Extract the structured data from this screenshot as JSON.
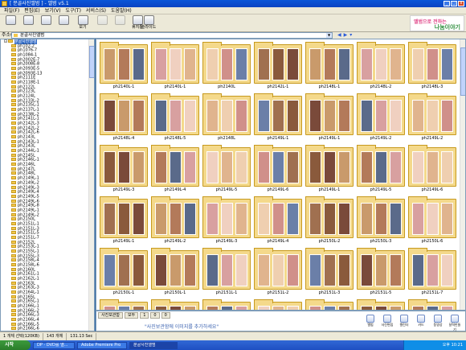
{
  "window": {
    "title": "[ 분골사진앨범 ] - 앨범 v5.1",
    "buttons": [
      "_",
      "□",
      "x"
    ]
  },
  "menu": [
    "파일(F)",
    "편집(E)",
    "보기(V)",
    "도구(T)",
    "서비스(S)",
    "도움말(H)"
  ],
  "toolbar": {
    "buttons": [
      {
        "label": "",
        "icon": "back-icon"
      },
      {
        "label": "",
        "icon": "forward-icon"
      },
      {
        "label": "",
        "icon": "up-folder-icon"
      },
      {
        "label": "",
        "icon": "refresh-icon"
      },
      {
        "label": "보기",
        "icon": "view-icon"
      },
      {
        "label": "",
        "icon": "copy-icon"
      },
      {
        "label": "",
        "icon": "paste-icon"
      },
      {
        "label": "휴지통",
        "icon": "trash-icon"
      },
      {
        "label": "슬라이드",
        "icon": "slideshow-icon"
      }
    ],
    "banner_line1": "앨범으로 전하는",
    "banner_line2": "나눔이야기"
  },
  "address": {
    "label": "주소(D)",
    "value": "분골사진앨범"
  },
  "tree": {
    "root": "분골사진앨범",
    "items": [
      "ph102-2",
      "ph1076-7",
      "ph1084-1",
      "ph2002E-7",
      "ph2008E-8",
      "ph2093E-5",
      "ph2093E-13",
      "ph2111E",
      "ph2118E-1",
      "ph2122L",
      "ph2123L",
      "ph2124L",
      "ph2133L-2",
      "ph2135L-1",
      "ph2137L-1",
      "ph2138L-2",
      "ph2141L-1",
      "ph2142L-3",
      "ph2142L-2",
      "ph2142L-6",
      "ph2143L",
      "ph2143L-1",
      "ph2143L",
      "ph2144L-1",
      "ph2145L",
      "ph2146L-1",
      "ph2146L",
      "ph2147L",
      "ph2148L",
      "ph2149L-1",
      "ph2149L-2",
      "ph2149L-3",
      "ph2149L-4",
      "ph2149L-5",
      "ph2149L-6",
      "ph2149L-8",
      "ph2149L-1",
      "ph2149L-2",
      "ph2150L",
      "ph2151L-1",
      "ph2151L-3",
      "ph2151L-5",
      "ph2151L-7",
      "ph2152L",
      "ph2153L-1",
      "ph2155L-1",
      "ph2155L-3",
      "ph2158L-4",
      "ph2158L-6",
      "ph2160L",
      "ph2161L-1",
      "ph2162L-1",
      "ph2163L",
      "ph2163L-3",
      "ph2164L-1",
      "ph2165L",
      "ph2165L-1",
      "ph2166L-1",
      "ph2166L-2",
      "ph2166L-3",
      "ph2166L-4",
      "ph2166L-5",
      "ph2166L-6",
      "ph2167L"
    ]
  },
  "grid": {
    "columns": 7,
    "rows": [
      [
        "ph2140L-1",
        "ph2140L-1",
        "ph2140L",
        "ph2142L-1",
        "ph2148L-1",
        "ph2148L-2",
        "ph2148L-3"
      ],
      [
        "ph2148L-4",
        "ph2148L-5",
        "ph2148L",
        "ph2149L-1",
        "ph2149L-1",
        "ph2149L-2",
        "ph2149L-2"
      ],
      [
        "ph2149L-3",
        "ph2149L-4",
        "ph2149L-5",
        "ph2149L-6",
        "ph2149L-1",
        "ph2149L-5",
        "ph2149L-6"
      ],
      [
        "ph2149L-1",
        "ph2149L-2",
        "ph2149L-3",
        "ph2149L-4",
        "ph2150L-2",
        "ph2150L-3",
        "ph2150L-6"
      ],
      [
        "ph2150L-1",
        "ph2150L-1",
        "ph2151L-1",
        "ph2151L-2",
        "ph2151L-3",
        "ph2151L-5",
        "ph2151L-7"
      ],
      [
        "ph2152L-2",
        "ph2153L-1",
        "ph2153L-2",
        "ph2153L-3",
        "ph2154L-1",
        "ph2155L-2",
        "ph2156L-2"
      ]
    ],
    "photo_colors": [
      "#c99a6b",
      "#e0b48e",
      "#8a5a3c",
      "#d8a0a0",
      "#6b7fa8",
      "#b37a5a",
      "#efcfb0",
      "#7a4a3a",
      "#f0d0c0",
      "#a07050",
      "#5a6a8a",
      "#d0908a"
    ]
  },
  "lower": {
    "tabs": [
      "사진보관함",
      "모두",
      "1",
      "0",
      "0"
    ],
    "message": "\"사진보관함에 이미지를 추가하세요\"",
    "buttons": [
      {
        "label": "앨범",
        "icon": "album-icon"
      },
      {
        "label": "사진편집",
        "icon": "photo-edit-icon"
      },
      {
        "label": "캘린더",
        "icon": "calendar-icon"
      },
      {
        "label": "카드",
        "icon": "card-icon"
      },
      {
        "label": "동영상",
        "icon": "video-icon"
      },
      {
        "label": "달력만들기",
        "icon": "make-calendar-icon"
      }
    ]
  },
  "status": [
    "1 개체 선택(120KB)",
    "143 개체",
    "131.13 Sec"
  ],
  "taskbar": {
    "start": "시작",
    "tasks": [
      "DP - DVD를 앨...",
      "Adobe Premiere Pro",
      "분골사진앨범"
    ],
    "tray": "오후 10:21"
  }
}
